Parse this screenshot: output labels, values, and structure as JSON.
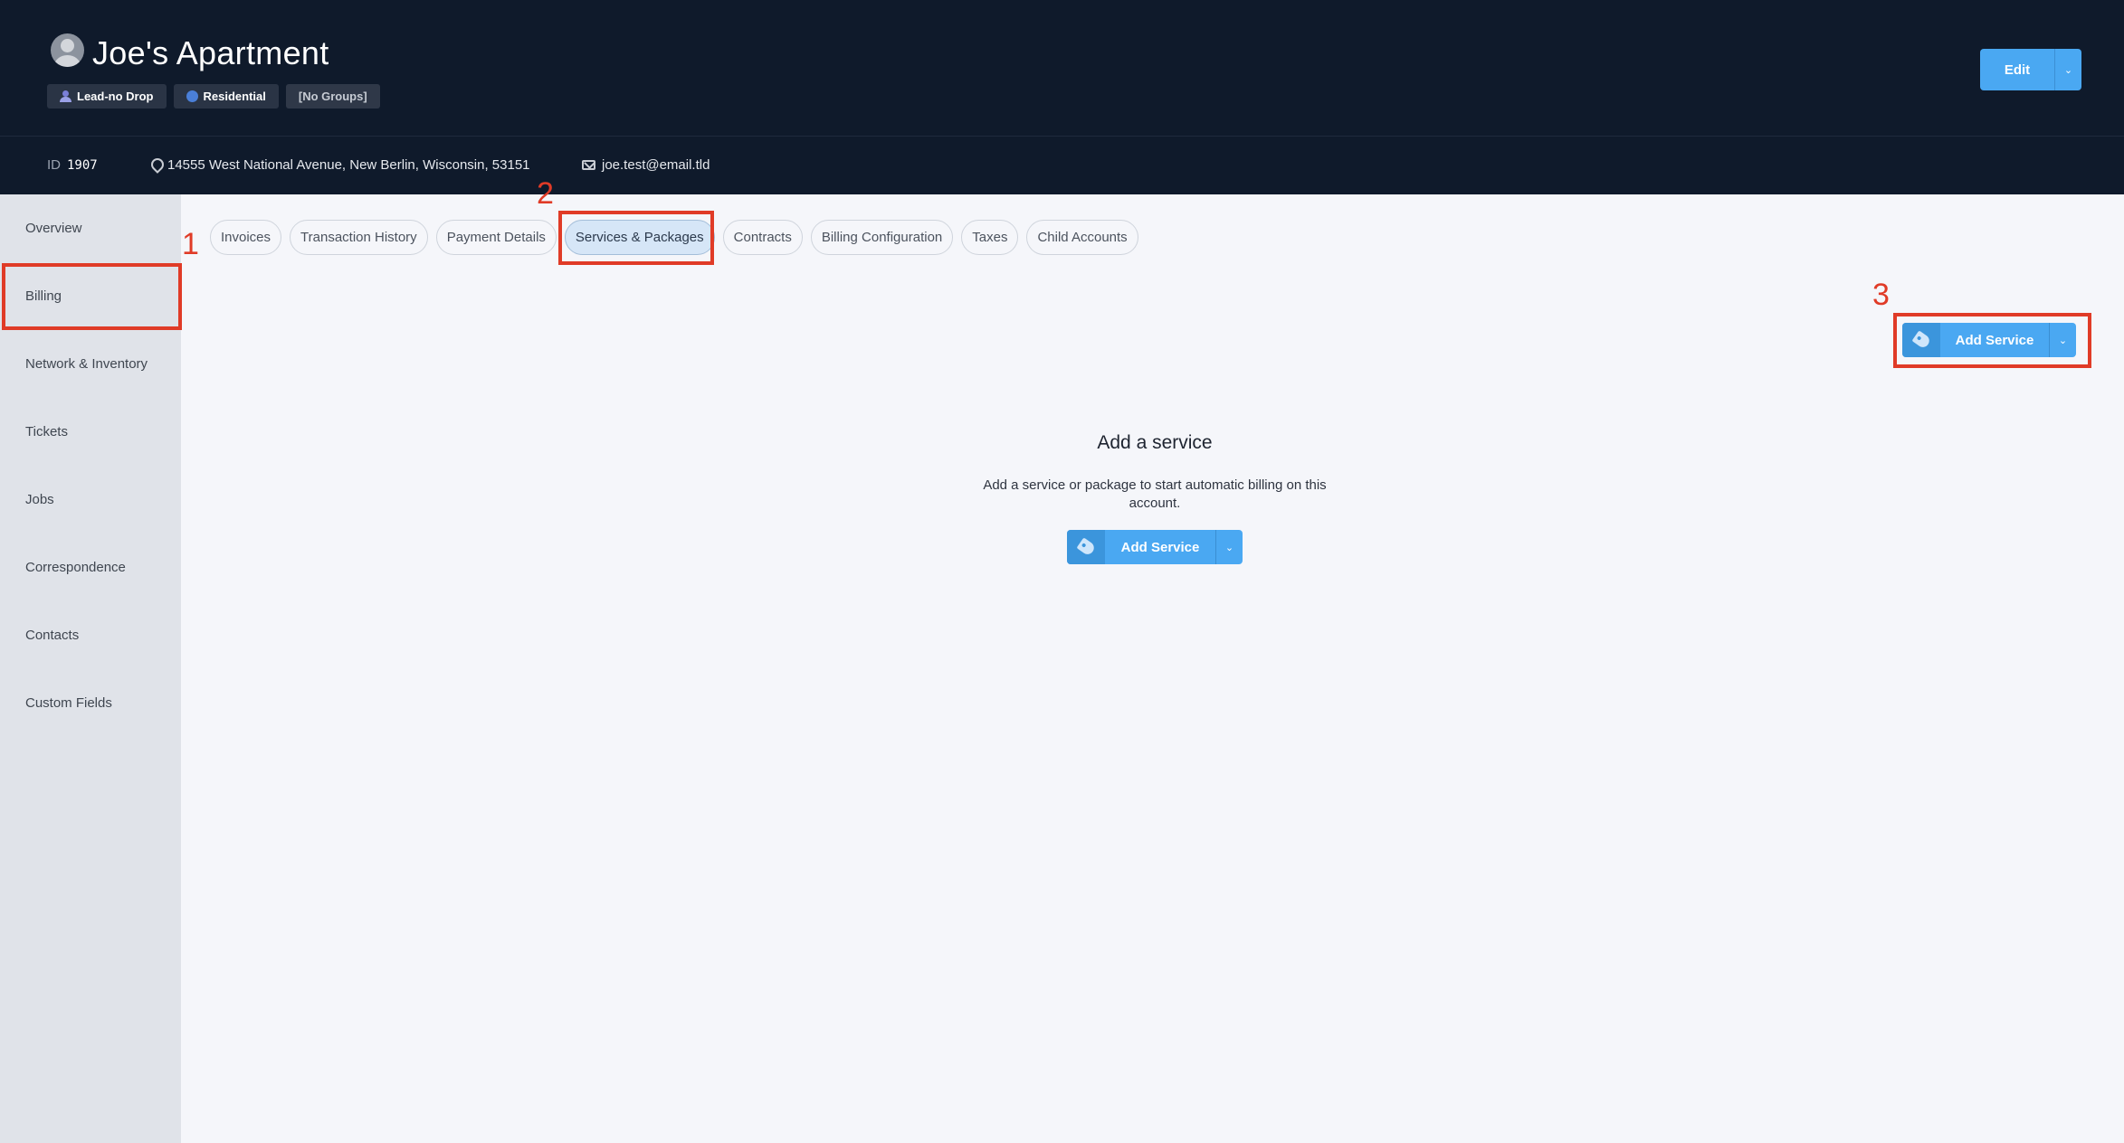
{
  "header": {
    "account_title": "Joe's Apartment",
    "tags": [
      {
        "label": "Lead-no Drop",
        "icon": "person-icon"
      },
      {
        "label": "Residential",
        "icon": "dot-icon"
      },
      {
        "label": "[No Groups]"
      }
    ],
    "edit_label": "Edit",
    "edit_caret": "⌄"
  },
  "info": {
    "id_label": "ID",
    "id_value": "1907",
    "address": "14555 West National Avenue, New Berlin, Wisconsin, 53151",
    "email": "joe.test@email.tld"
  },
  "sidebar": {
    "items": [
      {
        "label": "Overview"
      },
      {
        "label": "Billing"
      },
      {
        "label": "Network & Inventory"
      },
      {
        "label": "Tickets"
      },
      {
        "label": "Jobs"
      },
      {
        "label": "Correspondence"
      },
      {
        "label": "Contacts"
      },
      {
        "label": "Custom Fields"
      }
    ]
  },
  "tabs": [
    {
      "label": "Invoices"
    },
    {
      "label": "Transaction History"
    },
    {
      "label": "Payment Details"
    },
    {
      "label": "Services & Packages",
      "active": true
    },
    {
      "label": "Contracts"
    },
    {
      "label": "Billing Configuration"
    },
    {
      "label": "Taxes"
    },
    {
      "label": "Child Accounts"
    }
  ],
  "toolbar": {
    "add_service_label": "Add Service",
    "caret": "⌄"
  },
  "empty_state": {
    "title": "Add a service",
    "description": "Add a service or package to start automatic billing on this account.",
    "button_label": "Add Service",
    "caret": "⌄"
  },
  "annotations": [
    {
      "number": "1"
    },
    {
      "number": "2"
    },
    {
      "number": "3"
    }
  ],
  "colors": {
    "header_bg": "#0f1a2b",
    "accent": "#4aa8f2",
    "highlight": "#e03b27",
    "active_tab": "#d6e6f7"
  }
}
